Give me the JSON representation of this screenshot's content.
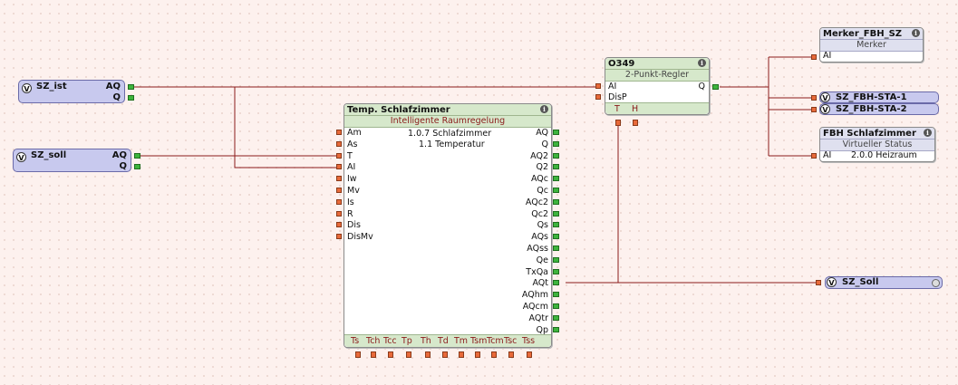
{
  "inputs": {
    "sz_ist": {
      "label": "SZ_ist",
      "out1": "AQ",
      "out2": "Q"
    },
    "sz_soll": {
      "label": "SZ_soll",
      "out1": "AQ",
      "out2": "Q"
    }
  },
  "main_block": {
    "title": "Temp. Schlafzimmer",
    "subtitle": "Intelligente Raumregelung",
    "line1": "1.0.7 Schlafzimmer",
    "line2": "1.1 Temperatur",
    "inputs": [
      "Am",
      "As",
      "T",
      "AI",
      "Iw",
      "Mv",
      "Is",
      "R",
      "Dis",
      "DisMv"
    ],
    "outputs": [
      "AQ",
      "Q",
      "AQ2",
      "Q2",
      "AQc",
      "Qc",
      "AQc2",
      "Qc2",
      "Qs",
      "AQs",
      "AQss",
      "Qe",
      "TxQa",
      "AQt",
      "AQhm",
      "AQcm",
      "AQtr",
      "Qp"
    ],
    "bottom": [
      "Ts",
      "Tch",
      "Tcc",
      "Tp",
      "Th",
      "Td",
      "Tm",
      "Tsm",
      "Tcm",
      "Tsc",
      "Tss"
    ]
  },
  "regler": {
    "title": "O349",
    "subtitle": "2-Punkt-Regler",
    "in1": "AI",
    "in2": "DisP",
    "out": "Q",
    "b1": "T",
    "b2": "H"
  },
  "merker": {
    "title": "Merker_FBH_SZ",
    "subtitle": "Merker",
    "in": "AI"
  },
  "sta1": {
    "label": "SZ_FBH-STA-1"
  },
  "sta2": {
    "label": "SZ_FBH-STA-2"
  },
  "fbh": {
    "title": "FBH Schlafzimmer",
    "subtitle": "Virtueller Status",
    "in": "AI",
    "value": "2.0.0 Heizraum"
  },
  "sz_soll_out": {
    "label": "SZ_Soll"
  },
  "badge": "V",
  "info": "i",
  "colors": {
    "wire": "#8b1a1a",
    "header": "#d6e8cb",
    "connector": "#c8c9ee"
  }
}
